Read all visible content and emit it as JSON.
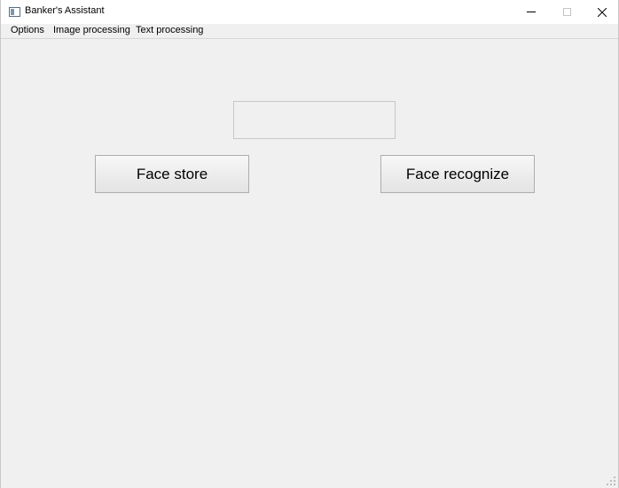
{
  "window": {
    "title": "Banker's Assistant",
    "icon": "app-window-icon",
    "controls": {
      "minimize_icon": "minimize-icon",
      "maximize_icon": "maximize-icon",
      "close_icon": "close-icon",
      "close_glyph": "✕",
      "maximize_enabled": false
    }
  },
  "menubar": {
    "items": [
      {
        "label": "Options"
      },
      {
        "label": "Image processing"
      },
      {
        "label": "Text processing"
      }
    ]
  },
  "main": {
    "display_text": "",
    "buttons": {
      "face_store": "Face store",
      "face_recognize": "Face recognize"
    }
  },
  "colors": {
    "window_background": "#f0f0f0",
    "titlebar_background": "#ffffff",
    "button_border": "#adadad"
  }
}
